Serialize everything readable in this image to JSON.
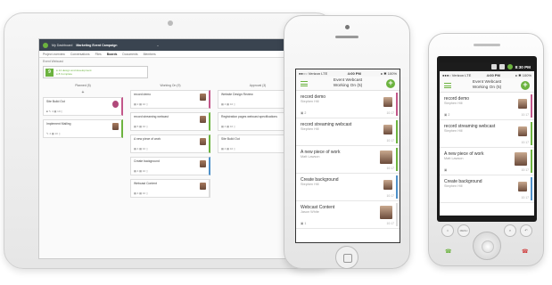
{
  "tablet": {
    "app_title": "My Dashboard",
    "project": "Marketing Event Campaign",
    "tabs": [
      "Project overview",
      "Conversations",
      "Files",
      "Boards",
      "Documents",
      "Members"
    ],
    "active_tab": 3,
    "breadcrumb": "Event Webcast",
    "tag_number": "9",
    "tag_line1": "● 14 design and development",
    "tag_line2": "● 8 Complete",
    "columns": [
      {
        "title": "Planned (5)",
        "cards": [
          {
            "title": "Site Build Out",
            "meta": "■ ✎ 4 ▦ 10 ▯",
            "color": "pink",
            "avatar": "circle"
          },
          {
            "title": "Implement Mailing",
            "meta": "✎ 4 ▦ 10 ▯",
            "color": "green",
            "avatar": "photo"
          }
        ]
      },
      {
        "title": "Working On (9)",
        "cards": [
          {
            "title": "record demo",
            "meta": "▦ 2 ▦ 10 ▯",
            "color": "pink",
            "avatar": "photo"
          },
          {
            "title": "record streaming webcast",
            "meta": "▦ 5 ▦ 10 ▯",
            "color": "green",
            "avatar": "photo"
          },
          {
            "title": "A new piece of work",
            "meta": "▦ 4 ▦ 10 ▯",
            "color": "green",
            "avatar": "photo"
          },
          {
            "title": "Create background",
            "meta": "▦ 4 ▦ 10 ▯",
            "color": "blue",
            "avatar": "photo"
          },
          {
            "title": "Webcast Content",
            "meta": "▦ 4 ▦ 10 ▯",
            "color": "plain",
            "avatar": "photo"
          }
        ]
      },
      {
        "title": "Approval (3)",
        "cards": [
          {
            "title": "Website Design Review",
            "meta": "▦ 4 ▦ 10 ▯",
            "color": "green",
            "avatar": "photo"
          },
          {
            "title": "Registration pages webcast specifications",
            "meta": "▦ 4 ▦ 10 ▯",
            "color": "green",
            "avatar": "photo"
          },
          {
            "title": "Site Build Out",
            "meta": "▦ 4 ▦ 10 ▯",
            "color": "pink",
            "avatar": "circle"
          }
        ]
      }
    ]
  },
  "iphone": {
    "status_left": "●●○○ Verizon LTE",
    "status_time": "4:00 PM",
    "status_right": "▸ ✱ 100%",
    "header_line1": "Event Webcast",
    "header_line2": "Working On (5)",
    "cards": [
      {
        "title": "record demo",
        "sub": "Stephen Hill",
        "meta": "▣ 2",
        "time": "10:17",
        "color": "pink",
        "avatar": "small"
      },
      {
        "title": "record streaming webcast",
        "sub": "Stephen Hill",
        "meta": "",
        "time": "10:17",
        "color": "green",
        "avatar": "small"
      },
      {
        "title": "A new piece of work",
        "sub": "Matt Lawson",
        "meta": "",
        "time": "10:17",
        "color": "green",
        "avatar": "big"
      },
      {
        "title": "Create background",
        "sub": "Stephen Hill",
        "meta": "",
        "time": "10:17",
        "color": "blue",
        "avatar": "small"
      },
      {
        "title": "Webcast Content",
        "sub": "Jason White",
        "meta": "▣ 1",
        "time": "10:17",
        "color": "plain",
        "avatar": "big"
      }
    ]
  },
  "android": {
    "top_time": "8:30 PM",
    "status_left": "●●●○ Verizon LTE",
    "status_time": "4:00 PM",
    "status_right": "▸ ✱ 100%",
    "header_line1": "Event Webcast",
    "header_line2": "Working On (5)",
    "cards": [
      {
        "title": "record demo",
        "sub": "Stephen Hill",
        "meta": "▣ 2",
        "time": "10:17",
        "color": "pink",
        "avatar": "small"
      },
      {
        "title": "record streaming webcast",
        "sub": "Stephen Hill",
        "meta": "",
        "time": "10:17",
        "color": "green",
        "avatar": "small"
      },
      {
        "title": "A new piece of work",
        "sub": "Matt Lawson",
        "meta": "▣",
        "time": "10:17",
        "color": "green",
        "avatar": "big"
      },
      {
        "title": "Create background",
        "sub": "Stephen Hill",
        "meta": "",
        "time": "10:17",
        "color": "blue",
        "avatar": "small"
      }
    ],
    "buttons": {
      "home": "⌂",
      "menu": "MENU",
      "search": "⌕",
      "back": "↶"
    }
  },
  "colors": {
    "accent": "#6cb33f",
    "pink": "#c2578a",
    "blue": "#4e90c9",
    "topbar": "#3a4450"
  }
}
